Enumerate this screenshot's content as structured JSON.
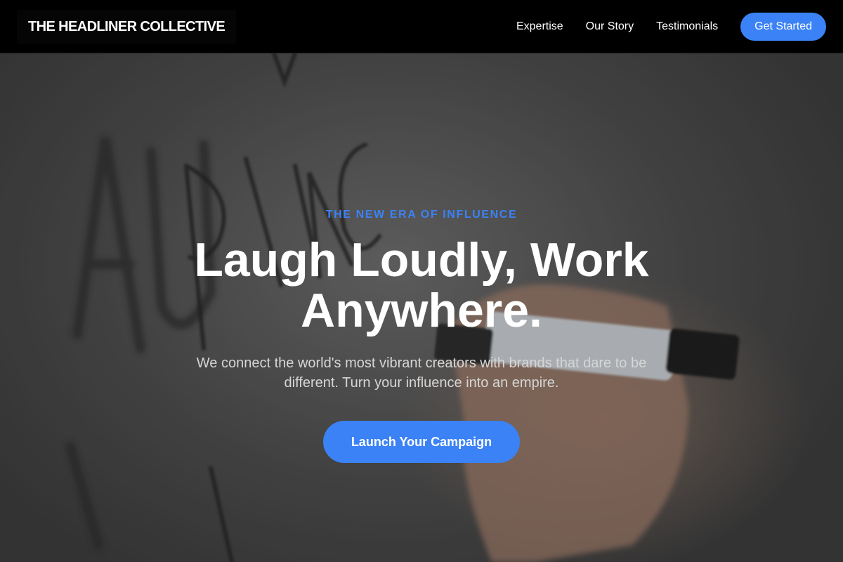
{
  "navbar": {
    "brand": "THE HEADLINER COLLECTIVE",
    "links": [
      {
        "label": "Expertise"
      },
      {
        "label": "Our Story"
      },
      {
        "label": "Testimonials"
      }
    ],
    "cta_label": "Get Started"
  },
  "hero": {
    "eyebrow": "THE NEW ERA OF INFLUENCE",
    "headline": "Laugh Loudly, Work Anywhere.",
    "subheadline": "We connect the world's most vibrant creators with brands that dare to be different. Turn your influence into an empire.",
    "cta_label": "Launch Your Campaign"
  },
  "colors": {
    "accent": "#3b82f6",
    "navbar_bg": "#000000",
    "text_primary": "#ffffff",
    "text_secondary": "#d6d6d6"
  }
}
